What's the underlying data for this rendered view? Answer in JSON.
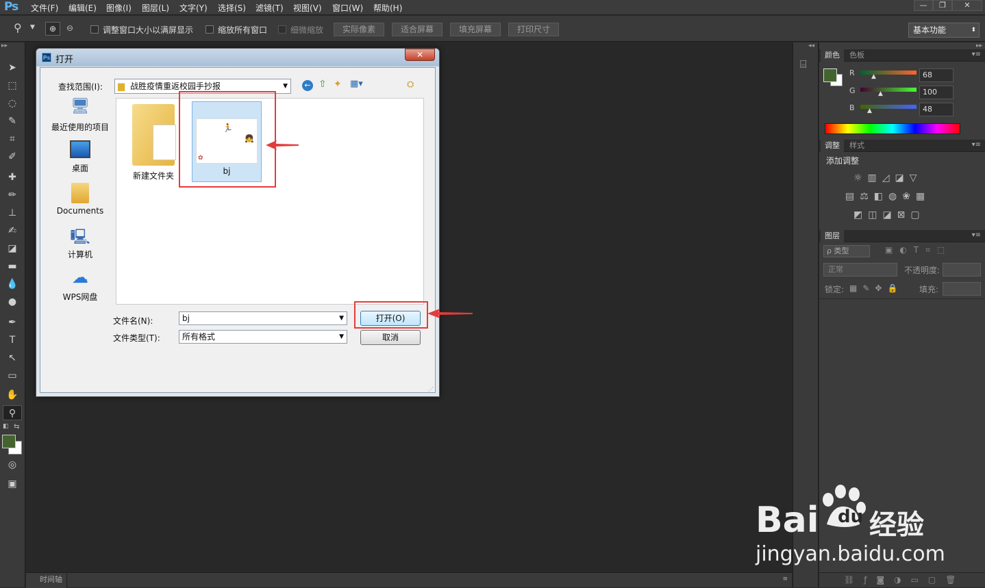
{
  "app": {
    "logo": "Ps",
    "menus": [
      "文件(F)",
      "编辑(E)",
      "图像(I)",
      "图层(L)",
      "文字(Y)",
      "选择(S)",
      "滤镜(T)",
      "视图(V)",
      "窗口(W)",
      "帮助(H)"
    ],
    "window_controls": [
      "minimize-icon",
      "restore-icon",
      "close-icon"
    ]
  },
  "options": {
    "zoom_tool_icon": "magnifier-icon",
    "checkbox_fit_window": "调整窗口大小以满屏显示",
    "checkbox_zoom_all": "缩放所有窗口",
    "checkbox_scrubby": "细微缩放",
    "btn_actual_pixels": "实际像素",
    "btn_fit_screen": "适合屏幕",
    "btn_fill_screen": "填充屏幕",
    "btn_print_size": "打印尺寸",
    "workspace": "基本功能"
  },
  "timeline": {
    "label": "时间轴"
  },
  "color_panel": {
    "tabs": [
      "颜色",
      "色板"
    ],
    "foreground": "#44642f",
    "r_label": "R",
    "g_label": "G",
    "b_label": "B",
    "r": "68",
    "g": "100",
    "b": "48"
  },
  "adjust_panel": {
    "tabs": [
      "调整",
      "样式"
    ],
    "title": "添加调整"
  },
  "layers_panel": {
    "title": "图层",
    "filter": "ρ 类型",
    "blend_mode": "正常",
    "opacity_label": "不透明度:",
    "lock_label": "锁定:",
    "fill_label": "填充:"
  },
  "dialog": {
    "title": "打开",
    "look_in_label": "查找范围(I):",
    "look_in_value": "战胜疫情重返校园手抄报",
    "places": [
      {
        "label": "最近使用的项目",
        "icon": "recent-items-icon"
      },
      {
        "label": "桌面",
        "icon": "desktop-icon"
      },
      {
        "label": "Documents",
        "icon": "documents-folder-icon"
      },
      {
        "label": "计算机",
        "icon": "computer-icon"
      },
      {
        "label": "WPS网盘",
        "icon": "wps-cloud-icon"
      }
    ],
    "files": [
      {
        "name": "新建文件夹",
        "type": "folder"
      },
      {
        "name": "bj",
        "type": "image"
      }
    ],
    "filename_label": "文件名(N):",
    "filename_value": "bj",
    "filetype_label": "文件类型(T):",
    "filetype_value": "所有格式",
    "open_button": "打开(O)",
    "cancel_button": "取消"
  },
  "watermark": {
    "brand": "Bai",
    "brand2": "du",
    "suffix": "经验",
    "url": "jingyan.baidu.com"
  },
  "colors": {
    "highlight": "#e43b3b",
    "ps_blue": "#5fb4f2"
  }
}
